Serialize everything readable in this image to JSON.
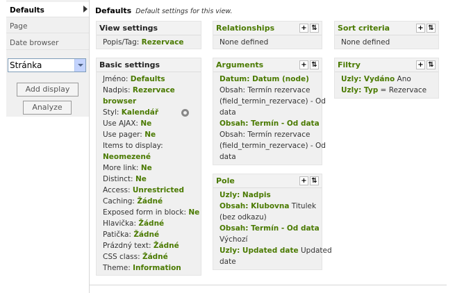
{
  "tabs": [
    "Defaults",
    "Page",
    "Date browser"
  ],
  "display_select": "Stránka",
  "buttons": {
    "add_display": "Add display",
    "analyze": "Analyze"
  },
  "header": {
    "title": "Defaults",
    "subtitle": "Default settings for this view."
  },
  "panels": {
    "view_settings": {
      "title": "View settings",
      "label": "Popis/Tag:",
      "value": "Rezervace"
    },
    "relationships": {
      "title": "Relationships",
      "text": "None defined"
    },
    "sort_criteria": {
      "title": "Sort criteria",
      "text": "None defined"
    },
    "basic_settings": {
      "title": "Basic settings",
      "rows": [
        {
          "label": "Jméno:",
          "value": "Defaults"
        },
        {
          "label": "Nadpis:",
          "value": "Rezervace"
        },
        {
          "label": "",
          "value": "browser"
        },
        {
          "label": "Styl:",
          "value": "Kalendář"
        },
        {
          "label": "Use AJAX:",
          "value": "Ne"
        },
        {
          "label": "Use pager:",
          "value": "Ne"
        },
        {
          "label": "Items to display:",
          "value": ""
        },
        {
          "label": "",
          "value": "Neomezené"
        },
        {
          "label": "More link:",
          "value": "Ne"
        },
        {
          "label": "Distinct:",
          "value": "Ne"
        },
        {
          "label": "Access:",
          "value": "Unrestricted"
        },
        {
          "label": "Caching:",
          "value": "Žádné"
        },
        {
          "label": "Exposed form in block:",
          "value": "Ne"
        },
        {
          "label": "Hlavička:",
          "value": "Žádné"
        },
        {
          "label": "Patička:",
          "value": "Žádné"
        },
        {
          "label": "Prázdný text:",
          "value": "Žádné"
        },
        {
          "label": "CSS class:",
          "value": "Žádné"
        },
        {
          "label": "Theme:",
          "value": "Information"
        }
      ]
    },
    "arguments": {
      "title": "Arguments",
      "items": [
        {
          "name": "Datum: Datum (node)",
          "desc": [
            "Obsah: Termín rezervace",
            "(field_termin_rezervace) - Od",
            "data"
          ]
        },
        {
          "name": "Obsah: Termín - Od data",
          "desc": [
            "Obsah: Termín rezervace",
            "(field_termin_rezervace) - Od",
            "data"
          ]
        }
      ]
    },
    "filtry": {
      "title": "Filtry",
      "items": [
        {
          "name": "Uzly: Vydáno",
          "rest": " Ano"
        },
        {
          "name": "Uzly: Typ",
          "rest": " = Rezervace"
        }
      ]
    },
    "pole": {
      "title": "Pole",
      "lines": [
        {
          "bold": "Uzly: Nadpis",
          "rest": ""
        },
        {
          "bold": "Obsah: Klubovna",
          "rest": " Titulek"
        },
        {
          "bold": "",
          "rest": "(bez odkazu)"
        },
        {
          "bold": "Obsah: Termín - Od data",
          "rest": ""
        },
        {
          "bold": "",
          "rest": "Výchozí"
        },
        {
          "bold": "Uzly: Updated date",
          "rest": " Updated"
        },
        {
          "bold": "",
          "rest": "date"
        }
      ]
    }
  }
}
